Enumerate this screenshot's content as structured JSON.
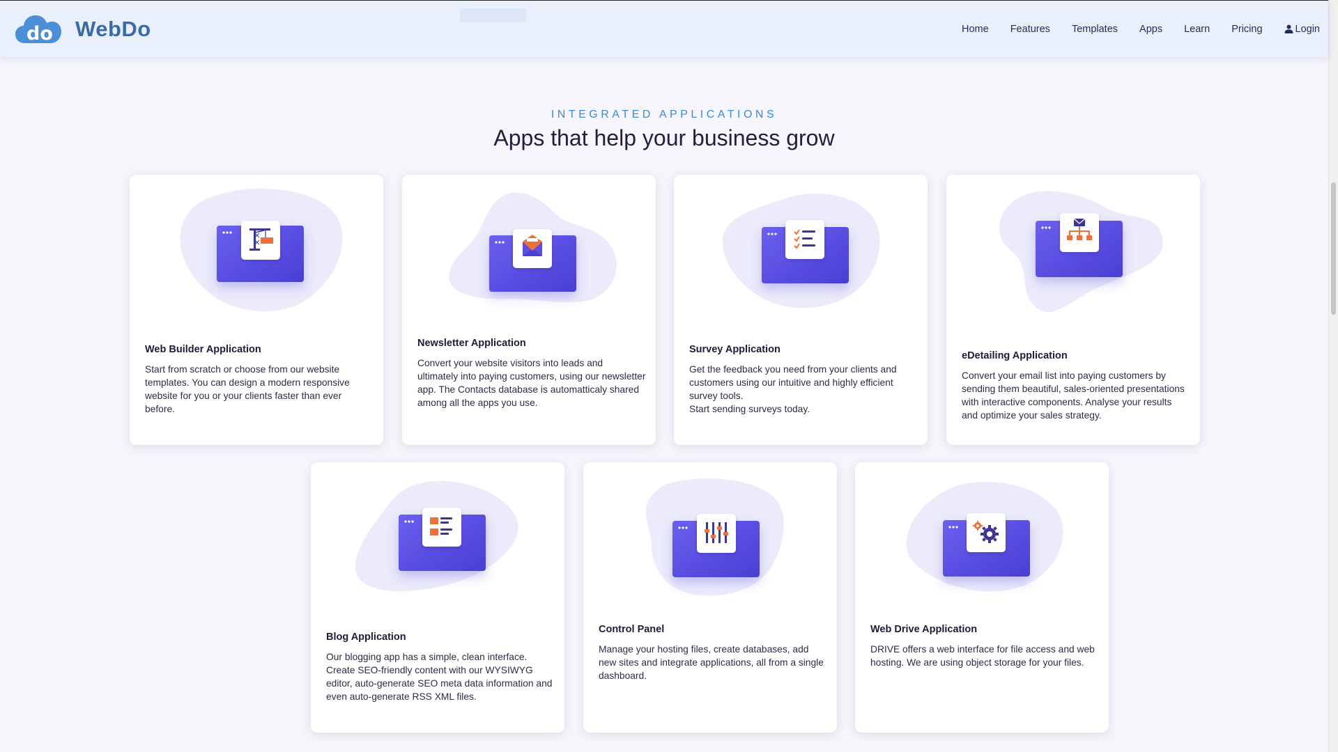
{
  "brand": {
    "name": "WebDo",
    "logo_text": "do"
  },
  "nav": {
    "home": "Home",
    "features": "Features",
    "templates": "Templates",
    "apps": "Apps",
    "learn": "Learn",
    "pricing": "Pricing",
    "login": "Login"
  },
  "section": {
    "eyebrow": "INTEGRATED APPLICATIONS",
    "title": "Apps that help your business grow"
  },
  "cards": [
    {
      "title": "Web Builder Application",
      "icon": "crane-icon",
      "desc": "Start from scratch or choose from our website templates. You can design a modern responsive website for you or your clients faster than ever before."
    },
    {
      "title": "Newsletter Application",
      "icon": "envelope-icon",
      "desc": "Convert your website visitors into leads and ultimately into paying customers, using our newsletter app. The Contacts database is automatticaly shared among all the apps you use."
    },
    {
      "title": "Survey Application",
      "icon": "checklist-icon",
      "desc": "Get the feedback you need from your clients and customers using our intuitive and highly efficient survey tools.\nStart sending surveys today."
    },
    {
      "title": "eDetailing Application",
      "icon": "org-chart-icon",
      "desc": "Convert your email list into paying customers by sending them beautiful, sales-oriented presentations with interactive components. Analyse your results and optimize your sales strategy."
    },
    {
      "title": "Blog Application",
      "icon": "blog-posts-icon",
      "desc": "Our blogging app has a simple, clean interface. Create SEO-friendly content with our WYSIWYG editor, auto-generate SEO meta data information and even auto-generate RSS XML files."
    },
    {
      "title": "Control Panel",
      "icon": "sliders-icon",
      "desc": "Manage your hosting files, create databases, add new sites and integrate applications, all from a single dashboard."
    },
    {
      "title": "Web Drive Application",
      "icon": "gears-icon",
      "desc": "DRIVE offers a web interface for file access and web hosting. We are using object storage for your files."
    }
  ],
  "colors": {
    "brand_blue": "#3b6aa9",
    "eyebrow_blue": "#3b8bd6",
    "window_purple": "#5b4fe0",
    "blob_lavender": "#ecebfb",
    "accent_orange": "#f0703a"
  }
}
